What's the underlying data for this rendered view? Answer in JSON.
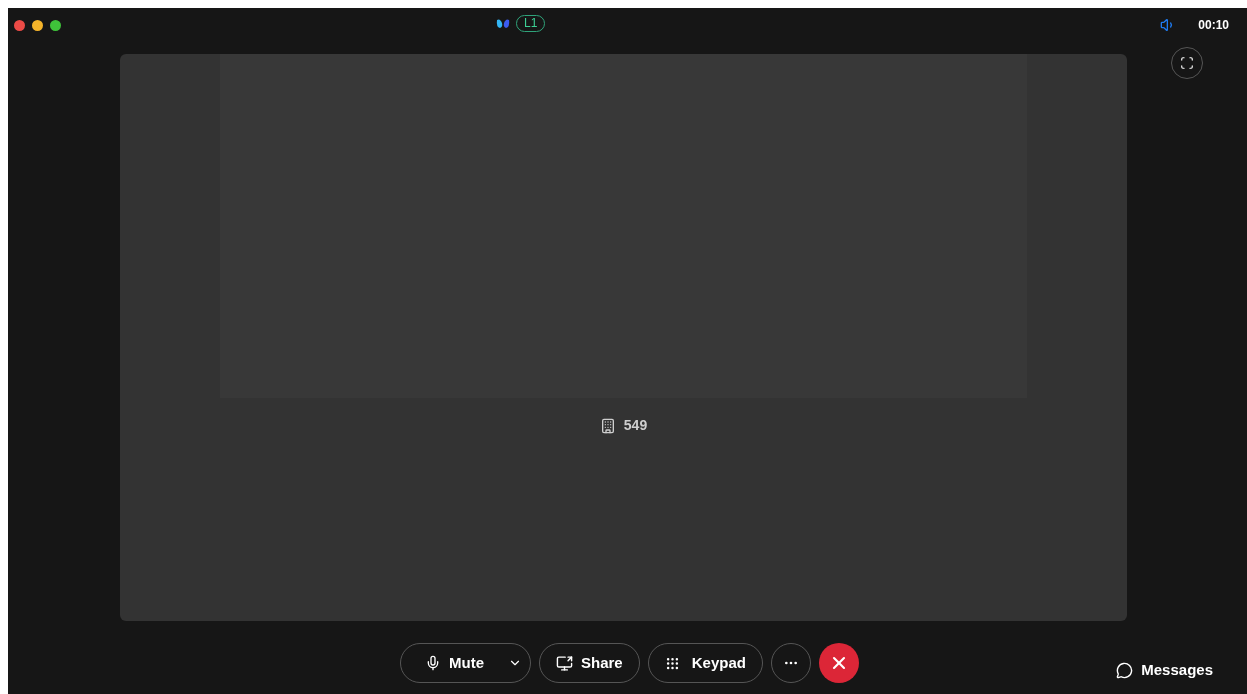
{
  "title_bar": {
    "line_badge": "L1",
    "timer": "00:10"
  },
  "call": {
    "caller": "549"
  },
  "controls": [
    {
      "kind": "mute",
      "label": "Mute"
    },
    {
      "kind": "share",
      "label": "Share"
    },
    {
      "kind": "keypad",
      "label": "Keypad"
    },
    {
      "kind": "more"
    },
    {
      "kind": "end"
    }
  ],
  "messages": {
    "label": "Messages"
  }
}
